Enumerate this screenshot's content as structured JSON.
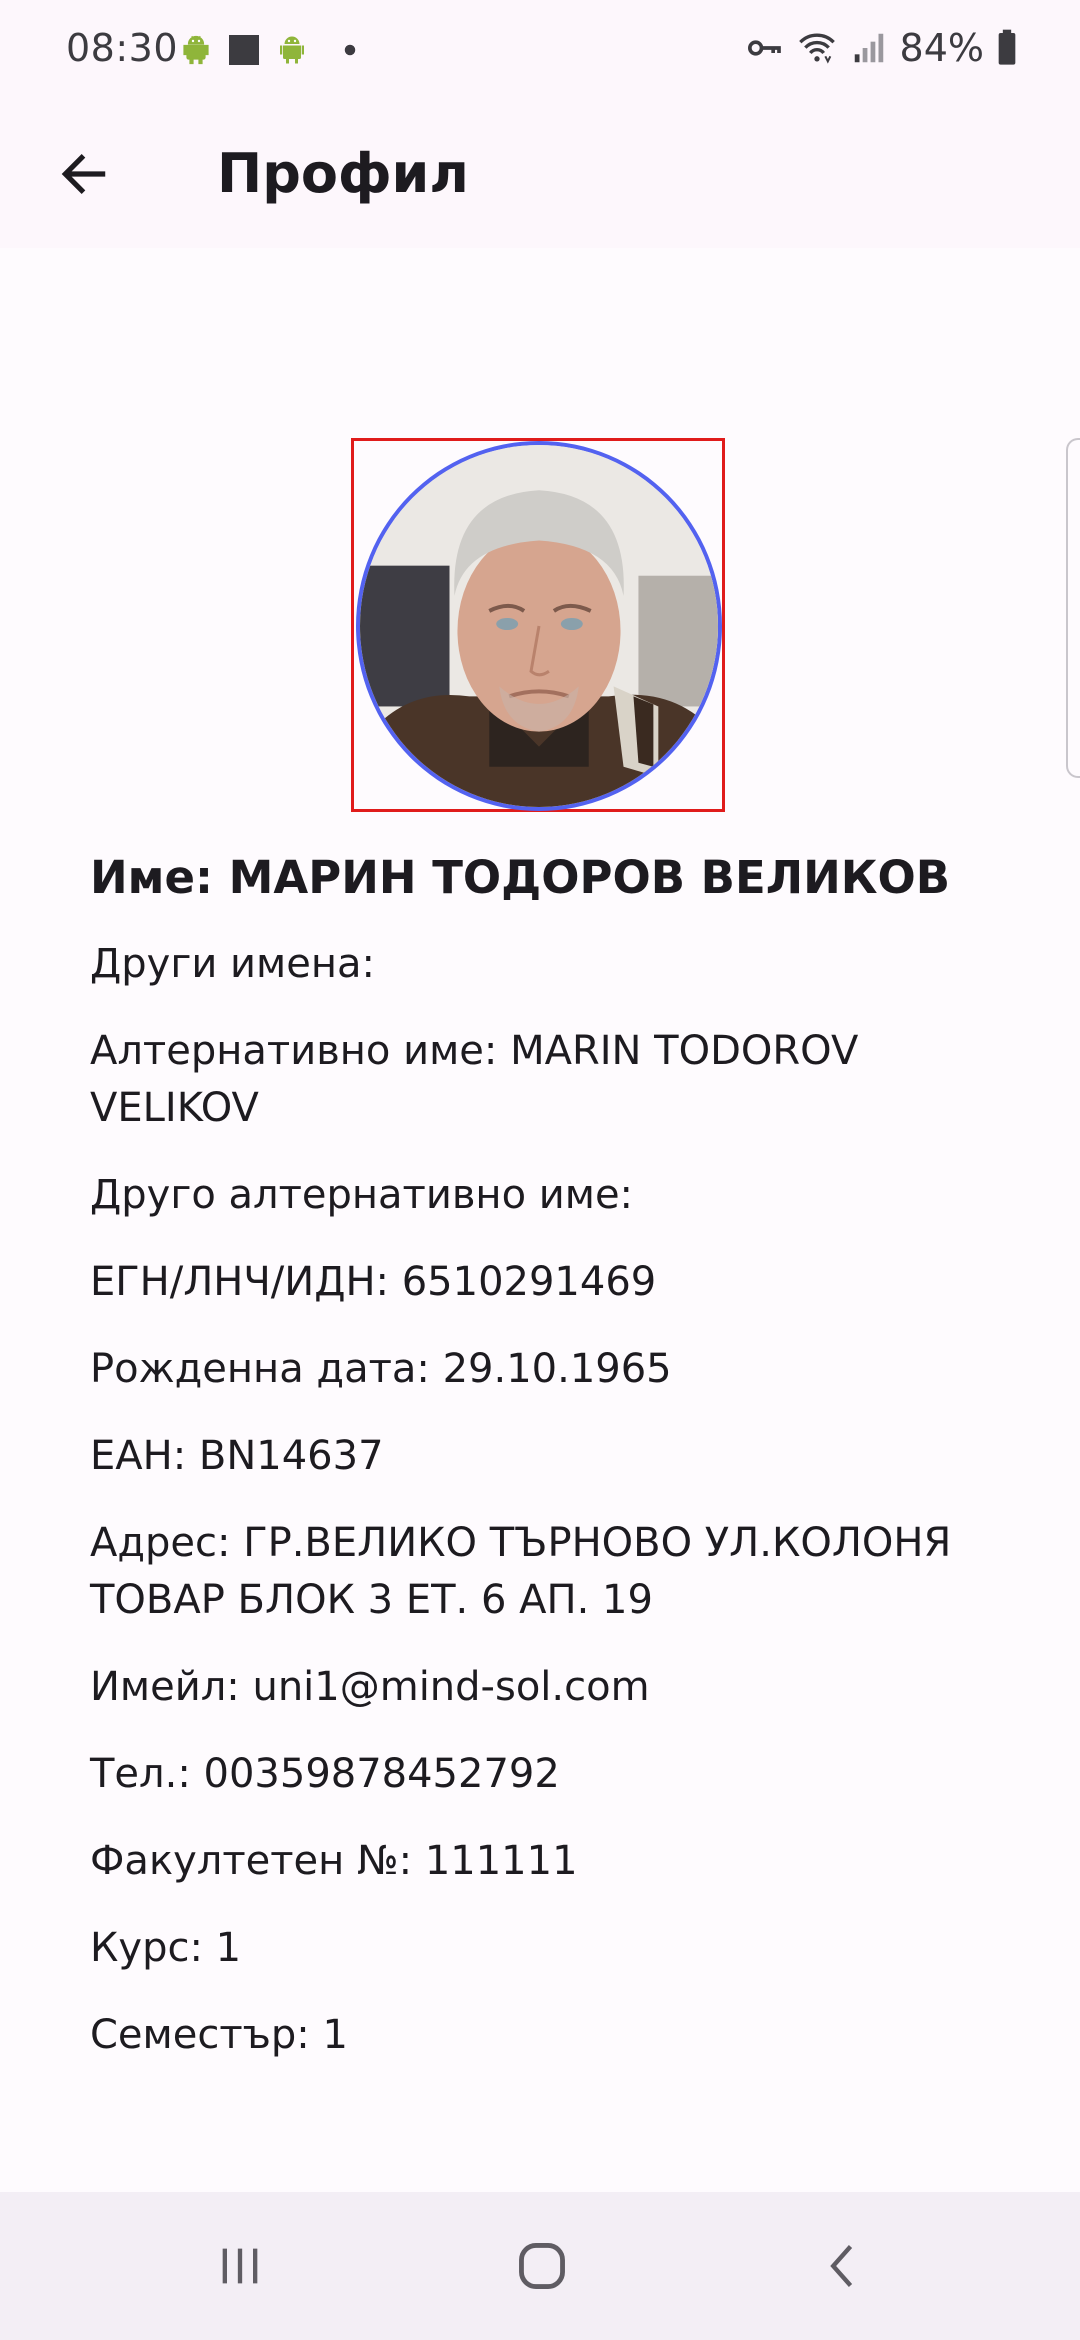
{
  "status_bar": {
    "time": "08:30",
    "battery": "84%",
    "left_icons": [
      "android-icon",
      "square-icon",
      "android-icon",
      "dot-icon"
    ],
    "right_icons": [
      "vpn-key-icon",
      "wifi-icon",
      "signal-icon",
      "battery-icon"
    ]
  },
  "app_bar": {
    "title": "Профил"
  },
  "profile": {
    "name_line": "Име: МАРИН ТОДОРОВ ВЕЛИКОВ",
    "fields": [
      "Други имена:",
      "Алтернативно име: MARIN TODOROV VELIKOV",
      "Друго алтернативно име:",
      "ЕГН/ЛНЧ/ИДН: 6510291469",
      "Рожденна дата: 29.10.1965",
      "ЕАН: BN14637",
      "Адрес: ГР.ВЕЛИКО ТЪРНОВО УЛ.КОЛОНЯ ТОВАР БЛОК 3 ЕТ. 6 АП. 19",
      "Имейл: uni1@mind-sol.com",
      "Тел.: 00359878452792",
      "Факултетен №: 111111",
      "Курс: 1",
      "Семестър: 1"
    ]
  },
  "colors": {
    "avatar_frame": "#e01b1b",
    "avatar_ring": "#5362f0",
    "app_bar_bg": "#fdf7fc",
    "nav_bar_bg": "#f3eef5"
  }
}
